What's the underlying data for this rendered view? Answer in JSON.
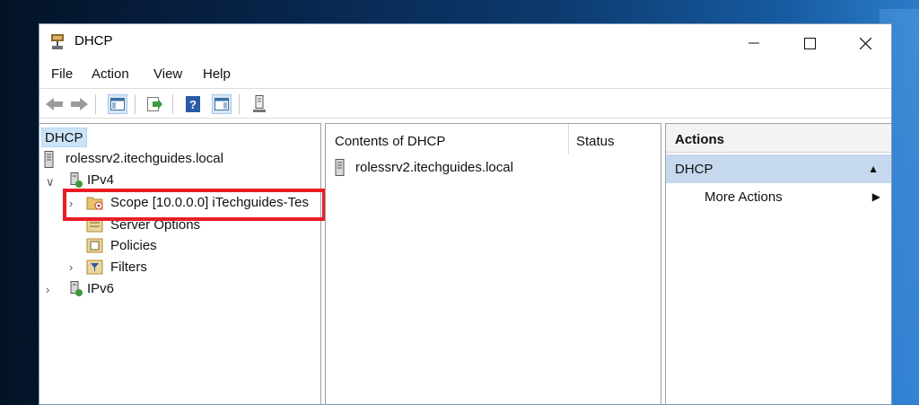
{
  "window": {
    "title": "DHCP",
    "controls": {
      "minimize": "—",
      "maximize": "☐",
      "close": "✕"
    }
  },
  "menu": [
    "File",
    "Action",
    "View",
    "Help"
  ],
  "toolbar": {
    "icons": [
      "back-icon",
      "forward-icon",
      "show-hide-tree-icon",
      "export-list-icon",
      "help-icon",
      "show-hide-action-pane-icon",
      "server-icon"
    ]
  },
  "tree": {
    "root": "DHCP",
    "server": "rolessrv2.itechguides.local",
    "ipv4": "IPv4",
    "scope": "Scope [10.0.0.0] iTechguides-Tes",
    "server_options": "Server Options",
    "policies": "Policies",
    "filters": "Filters",
    "ipv6": "IPv6"
  },
  "content": {
    "header_name": "Contents of DHCP",
    "header_status": "Status",
    "rows": [
      "rolessrv2.itechguides.local"
    ]
  },
  "actions": {
    "title": "Actions",
    "group": "DHCP",
    "more": "More Actions"
  },
  "colors": {
    "highlight": "#ec1c24",
    "selection": "#cce4f7",
    "action_group": "#c5d8ee"
  }
}
